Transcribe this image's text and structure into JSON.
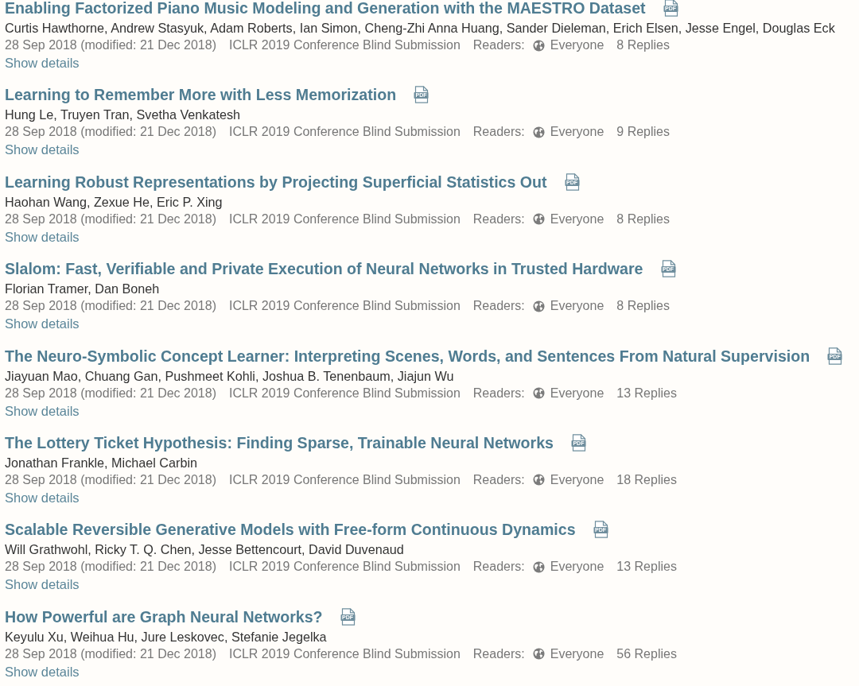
{
  "notes": [
    {
      "title": "Enabling Factorized Piano Music Modeling and Generation with the MAESTRO Dataset",
      "pdf_label": "PDF",
      "authors": "Curtis Hawthorne, Andrew Stasyuk, Adam Roberts, Ian Simon, Cheng-Zhi Anna Huang, Sander Dieleman, Erich Elsen, Jesse Engel, Douglas Eck",
      "date": "28 Sep 2018 (modified: 21 Dec 2018)",
      "venue": "ICLR 2019 Conference Blind Submission",
      "readers_label": "Readers:",
      "readers": "Everyone",
      "replies": "8 Replies",
      "details_link": "Show details"
    },
    {
      "title": "Learning to Remember More with Less Memorization",
      "pdf_label": "PDF",
      "authors": "Hung Le, Truyen Tran, Svetha Venkatesh",
      "date": "28 Sep 2018 (modified: 21 Dec 2018)",
      "venue": "ICLR 2019 Conference Blind Submission",
      "readers_label": "Readers:",
      "readers": "Everyone",
      "replies": "9 Replies",
      "details_link": "Show details"
    },
    {
      "title": "Learning Robust Representations by Projecting Superficial Statistics Out",
      "pdf_label": "PDF",
      "authors": "Haohan Wang, Zexue He, Eric P. Xing",
      "date": "28 Sep 2018 (modified: 21 Dec 2018)",
      "venue": "ICLR 2019 Conference Blind Submission",
      "readers_label": "Readers:",
      "readers": "Everyone",
      "replies": "8 Replies",
      "details_link": "Show details"
    },
    {
      "title": "Slalom: Fast, Verifiable and Private Execution of Neural Networks in Trusted Hardware",
      "pdf_label": "PDF",
      "authors": "Florian Tramer, Dan Boneh",
      "date": "28 Sep 2018 (modified: 21 Dec 2018)",
      "venue": "ICLR 2019 Conference Blind Submission",
      "readers_label": "Readers:",
      "readers": "Everyone",
      "replies": "8 Replies",
      "details_link": "Show details"
    },
    {
      "title": "The Neuro-Symbolic Concept Learner: Interpreting Scenes, Words, and Sentences From Natural Supervision",
      "pdf_label": "PDF",
      "authors": "Jiayuan Mao, Chuang Gan, Pushmeet Kohli, Joshua B. Tenenbaum, Jiajun Wu",
      "date": "28 Sep 2018 (modified: 21 Dec 2018)",
      "venue": "ICLR 2019 Conference Blind Submission",
      "readers_label": "Readers:",
      "readers": "Everyone",
      "replies": "13 Replies",
      "details_link": "Show details"
    },
    {
      "title": "The Lottery Ticket Hypothesis: Finding Sparse, Trainable Neural Networks",
      "pdf_label": "PDF",
      "authors": "Jonathan Frankle, Michael Carbin",
      "date": "28 Sep 2018 (modified: 21 Dec 2018)",
      "venue": "ICLR 2019 Conference Blind Submission",
      "readers_label": "Readers:",
      "readers": "Everyone",
      "replies": "18 Replies",
      "details_link": "Show details"
    },
    {
      "title": "Scalable Reversible Generative Models with Free-form Continuous Dynamics",
      "pdf_label": "PDF",
      "authors": "Will Grathwohl, Ricky T. Q. Chen, Jesse Bettencourt, David Duvenaud",
      "date": "28 Sep 2018 (modified: 21 Dec 2018)",
      "venue": "ICLR 2019 Conference Blind Submission",
      "readers_label": "Readers:",
      "readers": "Everyone",
      "replies": "13 Replies",
      "details_link": "Show details"
    },
    {
      "title": "How Powerful are Graph Neural Networks?",
      "pdf_label": "PDF",
      "authors": "Keyulu Xu, Weihua Hu, Jure Leskovec, Stefanie Jegelka",
      "date": "28 Sep 2018 (modified: 21 Dec 2018)",
      "venue": "ICLR 2019 Conference Blind Submission",
      "readers_label": "Readers:",
      "readers": "Everyone",
      "replies": "56 Replies",
      "details_link": "Show details"
    }
  ]
}
